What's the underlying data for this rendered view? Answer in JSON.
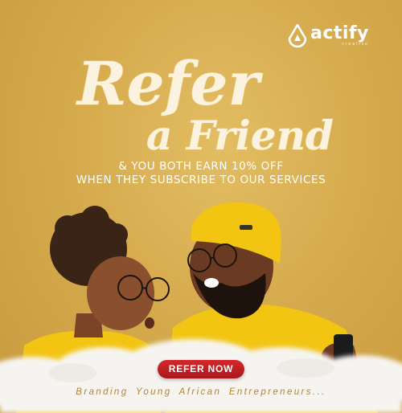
{
  "brand": {
    "name": "actify",
    "sub": "creative",
    "logo_icon": "drop-a-icon"
  },
  "headline": {
    "line1": "Refer",
    "line2": "a Friend"
  },
  "offer": {
    "line1": "& YOU BOTH EARN 10% OFF",
    "line2": "WHEN THEY SUBSCRIBE TO OUR SERVICES"
  },
  "cta": {
    "label": "REFER NOW"
  },
  "tagline": "Branding Young African Entrepreneurs...",
  "colors": {
    "background": "#d6ab4e",
    "script": "#fbf3df",
    "button": "#c41f24",
    "yellow_clothes": "#f2c513"
  }
}
